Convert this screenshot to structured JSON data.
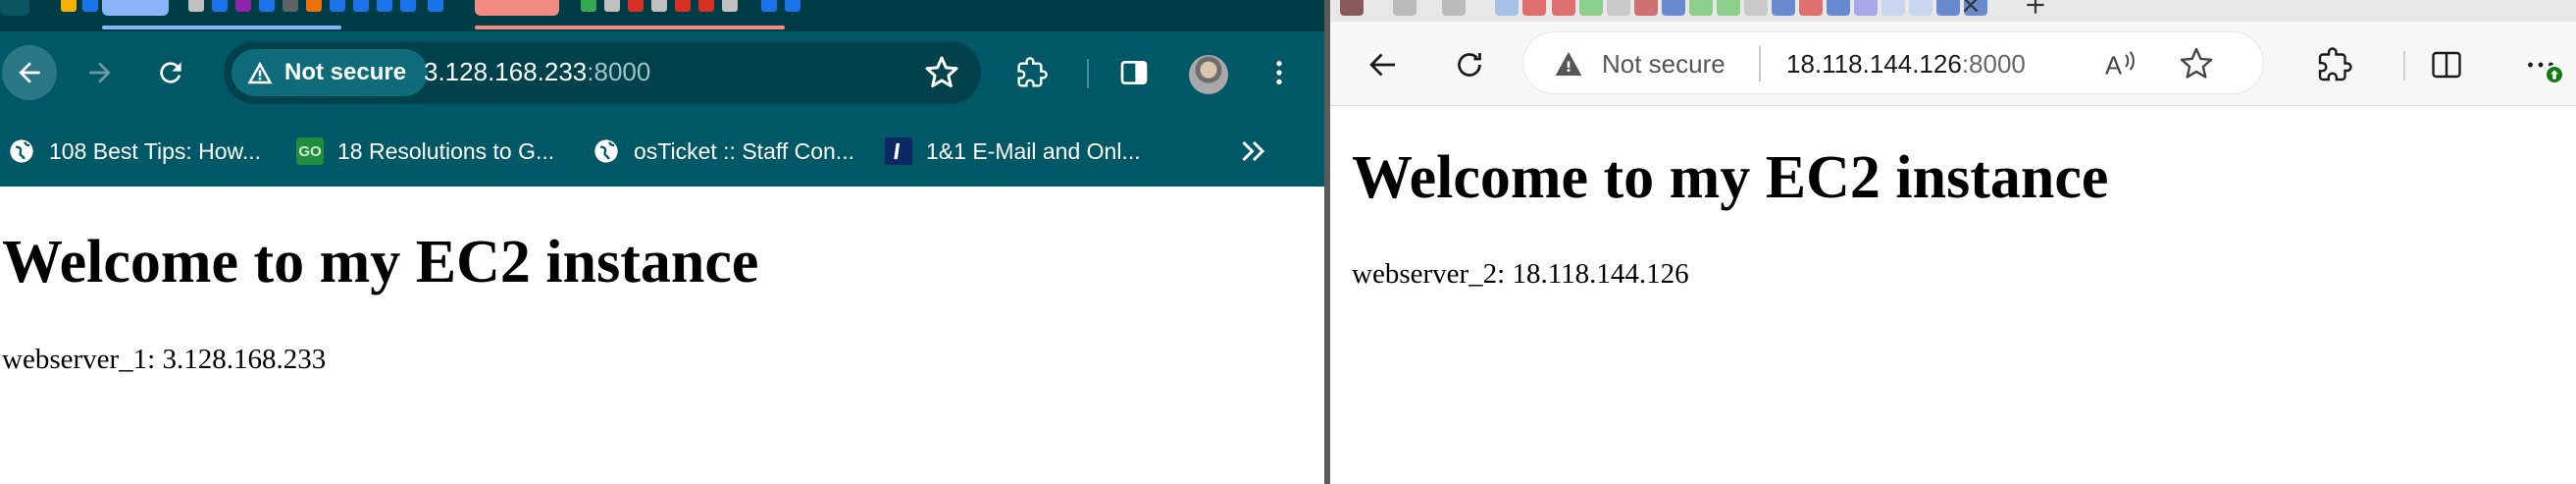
{
  "chrome": {
    "address": {
      "security_label": "Not secure",
      "host": "3.128.168.233",
      "port": ":8000"
    },
    "bookmarks": [
      {
        "label": "108 Best Tips: How...",
        "icon": "globe-icon"
      },
      {
        "label": "18 Resolutions to G...",
        "icon": "go-icon",
        "icon_text": "GO"
      },
      {
        "label": "osTicket :: Staff Con...",
        "icon": "globe-icon"
      },
      {
        "label": "1&1 E-Mail and Onl...",
        "icon": "ionos-icon"
      }
    ],
    "page": {
      "heading": "Welcome to my EC2 instance",
      "text": "webserver_1: 3.128.168.233"
    },
    "colors": {
      "toolbar": "#005766",
      "tabstrip": "#003c46",
      "omnibox": "#00414c"
    }
  },
  "edge": {
    "address": {
      "security_label": "Not secure",
      "host": "18.118.144.126",
      "port": ":8000"
    },
    "read_aloud_icon_text": "A",
    "page": {
      "heading": "Welcome to my EC2 instance",
      "text": "webserver_2: 18.118.144.126"
    },
    "colors": {
      "toolbar": "#f7f7f7",
      "update_badge": "#107c10"
    }
  }
}
